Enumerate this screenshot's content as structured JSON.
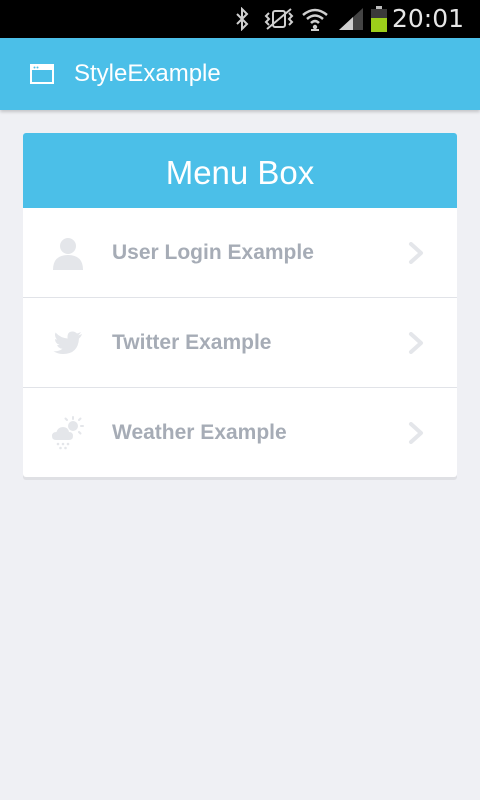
{
  "status_bar": {
    "time": "20:01",
    "icons": [
      "bluetooth-icon",
      "vibrate-icon",
      "wifi-icon",
      "signal-icon",
      "battery-icon"
    ]
  },
  "app_bar": {
    "title": "StyleExample",
    "icon": "app-window-icon",
    "color": "#4bbfe8"
  },
  "menu": {
    "title": "Menu Box",
    "items": [
      {
        "label": "User Login Example",
        "icon": "user-icon"
      },
      {
        "label": "Twitter Example",
        "icon": "twitter-icon"
      },
      {
        "label": "Weather Example",
        "icon": "weather-icon"
      }
    ]
  },
  "colors": {
    "accent": "#4bbfe8",
    "background": "#eff0f4",
    "item_text": "#a6acb6",
    "icon": "#e4e6ea"
  }
}
